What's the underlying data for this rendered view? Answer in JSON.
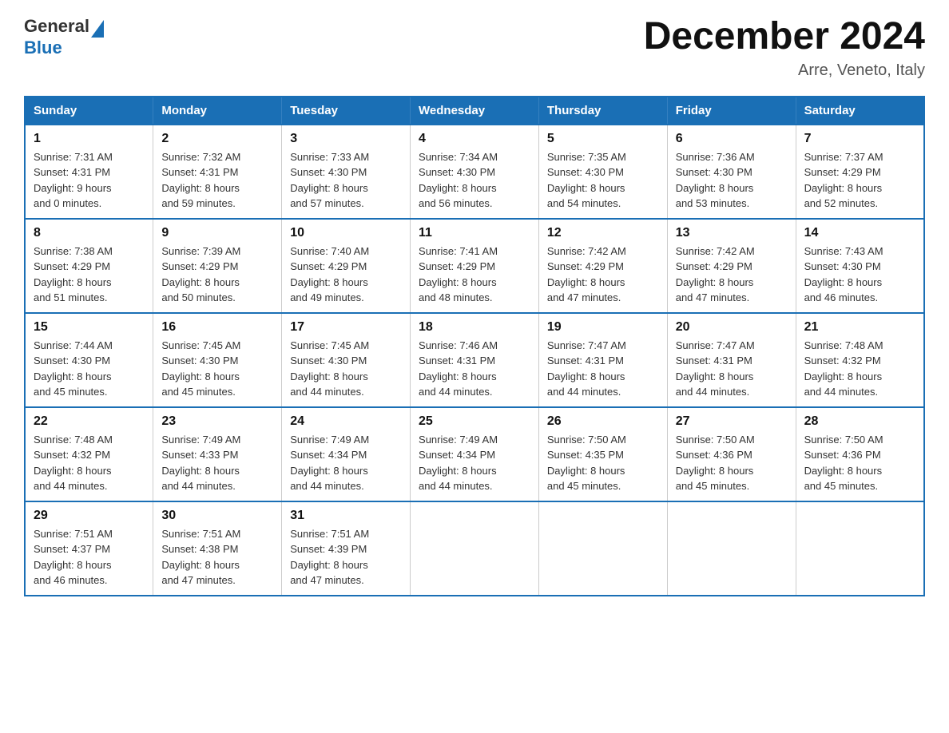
{
  "header": {
    "logo_line1": "General",
    "logo_line2": "Blue",
    "month_title": "December 2024",
    "location": "Arre, Veneto, Italy"
  },
  "days_of_week": [
    "Sunday",
    "Monday",
    "Tuesday",
    "Wednesday",
    "Thursday",
    "Friday",
    "Saturday"
  ],
  "weeks": [
    [
      {
        "day": "1",
        "sunrise": "7:31 AM",
        "sunset": "4:31 PM",
        "daylight_hours": "9 hours",
        "daylight_minutes": "0 minutes"
      },
      {
        "day": "2",
        "sunrise": "7:32 AM",
        "sunset": "4:31 PM",
        "daylight_hours": "8 hours",
        "daylight_minutes": "59 minutes"
      },
      {
        "day": "3",
        "sunrise": "7:33 AM",
        "sunset": "4:30 PM",
        "daylight_hours": "8 hours",
        "daylight_minutes": "57 minutes"
      },
      {
        "day": "4",
        "sunrise": "7:34 AM",
        "sunset": "4:30 PM",
        "daylight_hours": "8 hours",
        "daylight_minutes": "56 minutes"
      },
      {
        "day": "5",
        "sunrise": "7:35 AM",
        "sunset": "4:30 PM",
        "daylight_hours": "8 hours",
        "daylight_minutes": "54 minutes"
      },
      {
        "day": "6",
        "sunrise": "7:36 AM",
        "sunset": "4:30 PM",
        "daylight_hours": "8 hours",
        "daylight_minutes": "53 minutes"
      },
      {
        "day": "7",
        "sunrise": "7:37 AM",
        "sunset": "4:29 PM",
        "daylight_hours": "8 hours",
        "daylight_minutes": "52 minutes"
      }
    ],
    [
      {
        "day": "8",
        "sunrise": "7:38 AM",
        "sunset": "4:29 PM",
        "daylight_hours": "8 hours",
        "daylight_minutes": "51 minutes"
      },
      {
        "day": "9",
        "sunrise": "7:39 AM",
        "sunset": "4:29 PM",
        "daylight_hours": "8 hours",
        "daylight_minutes": "50 minutes"
      },
      {
        "day": "10",
        "sunrise": "7:40 AM",
        "sunset": "4:29 PM",
        "daylight_hours": "8 hours",
        "daylight_minutes": "49 minutes"
      },
      {
        "day": "11",
        "sunrise": "7:41 AM",
        "sunset": "4:29 PM",
        "daylight_hours": "8 hours",
        "daylight_minutes": "48 minutes"
      },
      {
        "day": "12",
        "sunrise": "7:42 AM",
        "sunset": "4:29 PM",
        "daylight_hours": "8 hours",
        "daylight_minutes": "47 minutes"
      },
      {
        "day": "13",
        "sunrise": "7:42 AM",
        "sunset": "4:29 PM",
        "daylight_hours": "8 hours",
        "daylight_minutes": "47 minutes"
      },
      {
        "day": "14",
        "sunrise": "7:43 AM",
        "sunset": "4:30 PM",
        "daylight_hours": "8 hours",
        "daylight_minutes": "46 minutes"
      }
    ],
    [
      {
        "day": "15",
        "sunrise": "7:44 AM",
        "sunset": "4:30 PM",
        "daylight_hours": "8 hours",
        "daylight_minutes": "45 minutes"
      },
      {
        "day": "16",
        "sunrise": "7:45 AM",
        "sunset": "4:30 PM",
        "daylight_hours": "8 hours",
        "daylight_minutes": "45 minutes"
      },
      {
        "day": "17",
        "sunrise": "7:45 AM",
        "sunset": "4:30 PM",
        "daylight_hours": "8 hours",
        "daylight_minutes": "44 minutes"
      },
      {
        "day": "18",
        "sunrise": "7:46 AM",
        "sunset": "4:31 PM",
        "daylight_hours": "8 hours",
        "daylight_minutes": "44 minutes"
      },
      {
        "day": "19",
        "sunrise": "7:47 AM",
        "sunset": "4:31 PM",
        "daylight_hours": "8 hours",
        "daylight_minutes": "44 minutes"
      },
      {
        "day": "20",
        "sunrise": "7:47 AM",
        "sunset": "4:31 PM",
        "daylight_hours": "8 hours",
        "daylight_minutes": "44 minutes"
      },
      {
        "day": "21",
        "sunrise": "7:48 AM",
        "sunset": "4:32 PM",
        "daylight_hours": "8 hours",
        "daylight_minutes": "44 minutes"
      }
    ],
    [
      {
        "day": "22",
        "sunrise": "7:48 AM",
        "sunset": "4:32 PM",
        "daylight_hours": "8 hours",
        "daylight_minutes": "44 minutes"
      },
      {
        "day": "23",
        "sunrise": "7:49 AM",
        "sunset": "4:33 PM",
        "daylight_hours": "8 hours",
        "daylight_minutes": "44 minutes"
      },
      {
        "day": "24",
        "sunrise": "7:49 AM",
        "sunset": "4:34 PM",
        "daylight_hours": "8 hours",
        "daylight_minutes": "44 minutes"
      },
      {
        "day": "25",
        "sunrise": "7:49 AM",
        "sunset": "4:34 PM",
        "daylight_hours": "8 hours",
        "daylight_minutes": "44 minutes"
      },
      {
        "day": "26",
        "sunrise": "7:50 AM",
        "sunset": "4:35 PM",
        "daylight_hours": "8 hours",
        "daylight_minutes": "45 minutes"
      },
      {
        "day": "27",
        "sunrise": "7:50 AM",
        "sunset": "4:36 PM",
        "daylight_hours": "8 hours",
        "daylight_minutes": "45 minutes"
      },
      {
        "day": "28",
        "sunrise": "7:50 AM",
        "sunset": "4:36 PM",
        "daylight_hours": "8 hours",
        "daylight_minutes": "45 minutes"
      }
    ],
    [
      {
        "day": "29",
        "sunrise": "7:51 AM",
        "sunset": "4:37 PM",
        "daylight_hours": "8 hours",
        "daylight_minutes": "46 minutes"
      },
      {
        "day": "30",
        "sunrise": "7:51 AM",
        "sunset": "4:38 PM",
        "daylight_hours": "8 hours",
        "daylight_minutes": "47 minutes"
      },
      {
        "day": "31",
        "sunrise": "7:51 AM",
        "sunset": "4:39 PM",
        "daylight_hours": "8 hours",
        "daylight_minutes": "47 minutes"
      },
      null,
      null,
      null,
      null
    ]
  ],
  "labels": {
    "sunrise": "Sunrise:",
    "sunset": "Sunset:",
    "daylight": "Daylight:",
    "and": "and"
  }
}
